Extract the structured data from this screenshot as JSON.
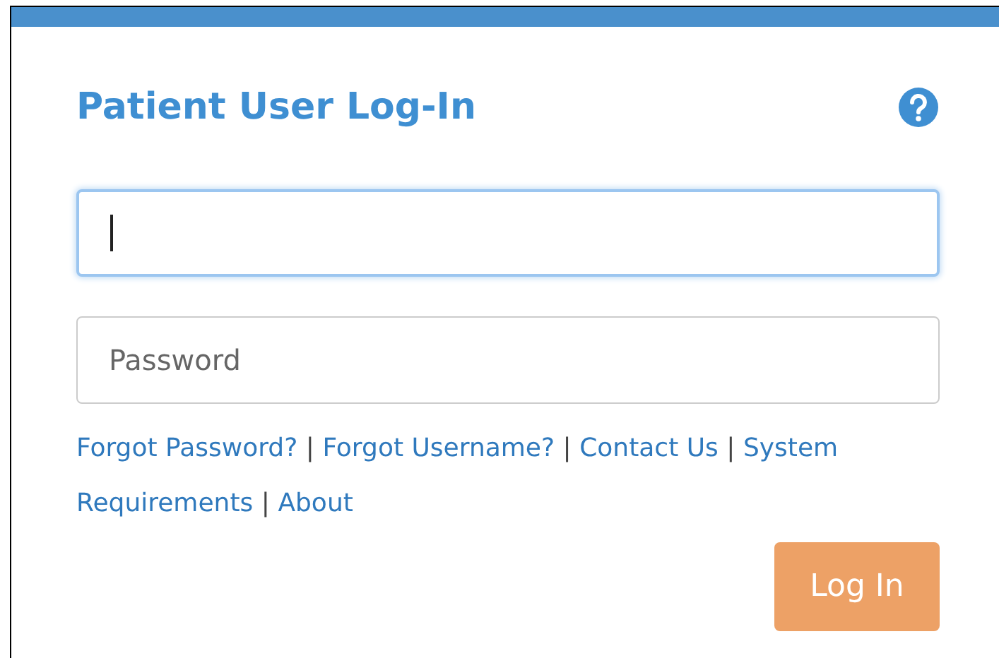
{
  "title": "Patient User Log-In",
  "fields": [
    {
      "focused": true
    },
    {
      "placeholder": "Password",
      "focused": false
    }
  ],
  "link_lines": [
    [
      {
        "kind": "link",
        "label": "Forgot Password?"
      },
      {
        "kind": "separator",
        "label": "|"
      },
      {
        "kind": "link",
        "label": "Forgot Username?"
      },
      {
        "kind": "separator",
        "label": "|"
      },
      {
        "kind": "link",
        "label": "Contact Us"
      },
      {
        "kind": "separator",
        "label": "|"
      },
      {
        "kind": "link",
        "label": "System"
      }
    ],
    [
      {
        "kind": "link",
        "label": "Requirements"
      },
      {
        "kind": "separator",
        "label": "|"
      },
      {
        "kind": "link",
        "label": "About"
      }
    ]
  ],
  "login_button": "Log In"
}
